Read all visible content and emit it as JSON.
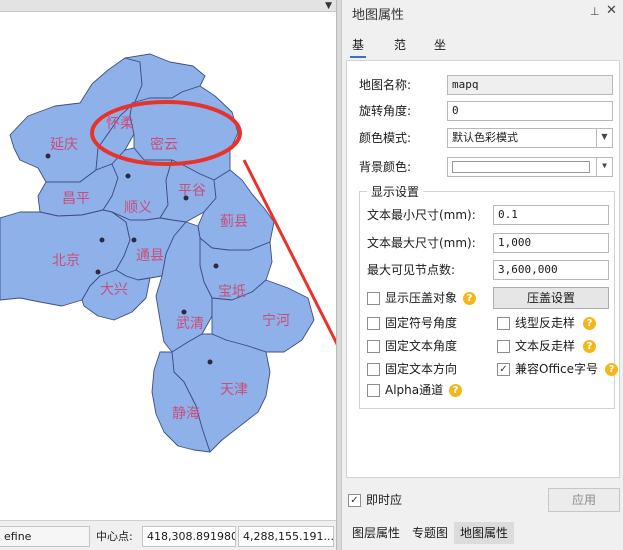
{
  "map": {
    "regions": [
      {
        "name": "延庆",
        "color": "#c94d7a"
      },
      {
        "name": "怀柔",
        "color": "#c94d7a"
      },
      {
        "name": "密云",
        "color": "#c94d7a"
      },
      {
        "name": "昌平",
        "color": "#c94d7a"
      },
      {
        "name": "顺义",
        "color": "#c94d7a"
      },
      {
        "name": "平谷",
        "color": "#c94d7a"
      },
      {
        "name": "蓟县",
        "color": "#c94d7a"
      },
      {
        "name": "北京",
        "color": "#c94d7a"
      },
      {
        "name": "通县",
        "color": "#c94d7a"
      },
      {
        "name": "大兴",
        "color": "#c94d7a"
      },
      {
        "name": "宝坻",
        "color": "#c94d7a"
      },
      {
        "name": "武清",
        "color": "#c94d7a"
      },
      {
        "name": "宁河",
        "color": "#c94d7a"
      },
      {
        "name": "天津",
        "color": "#c94d7a"
      },
      {
        "name": "静海",
        "color": "#c94d7a"
      }
    ],
    "fill_color": "#8fb1ea",
    "label_color": "#c94d7a",
    "annotation_color": "#e8332a"
  },
  "status": {
    "left_text": "efine",
    "center_label": "中心点:",
    "center_x": "418,308.891980",
    "center_y": "4,288,155.191..."
  },
  "panel": {
    "title": "地图属性",
    "pin_icon": "pin-icon",
    "close_icon": "close-icon",
    "tabs": [
      {
        "label": "基本",
        "active": true
      },
      {
        "label": "范围",
        "active": false
      },
      {
        "label": "坐标系统",
        "active": false
      }
    ],
    "map_name_label": "地图名称:",
    "map_name_value": "mapq",
    "rotation_label": "旋转角度:",
    "rotation_value": "0",
    "color_mode_label": "颜色模式:",
    "color_mode_value": "默认色彩模式",
    "bg_color_label": "背景颜色:",
    "display_group_title": "显示设置",
    "min_text_label": "文本最小尺寸(mm):",
    "min_text_value": "0.1",
    "max_text_label": "文本最大尺寸(mm):",
    "max_text_value": "1,000",
    "max_nodes_label": "最大可见节点数:",
    "max_nodes_value": "3,600,000",
    "overlap_label": "显示压盖对象",
    "overlap_button": "压盖设置",
    "fixed_symbol_label": "固定符号角度",
    "line_reverse_label": "线型反走样",
    "fixed_text_angle_label": "固定文本角度",
    "text_reverse_label": "文本反走样",
    "fixed_text_dir_label": "固定文本方向",
    "office_font_label": "兼容Office字号",
    "alpha_label": "Alpha通道",
    "realtime_label": "即时应",
    "apply_label": "应用",
    "bottom_tabs": [
      {
        "label": "图层属性",
        "active": false
      },
      {
        "label": "专题图",
        "active": false
      },
      {
        "label": "地图属性",
        "active": true
      }
    ]
  }
}
